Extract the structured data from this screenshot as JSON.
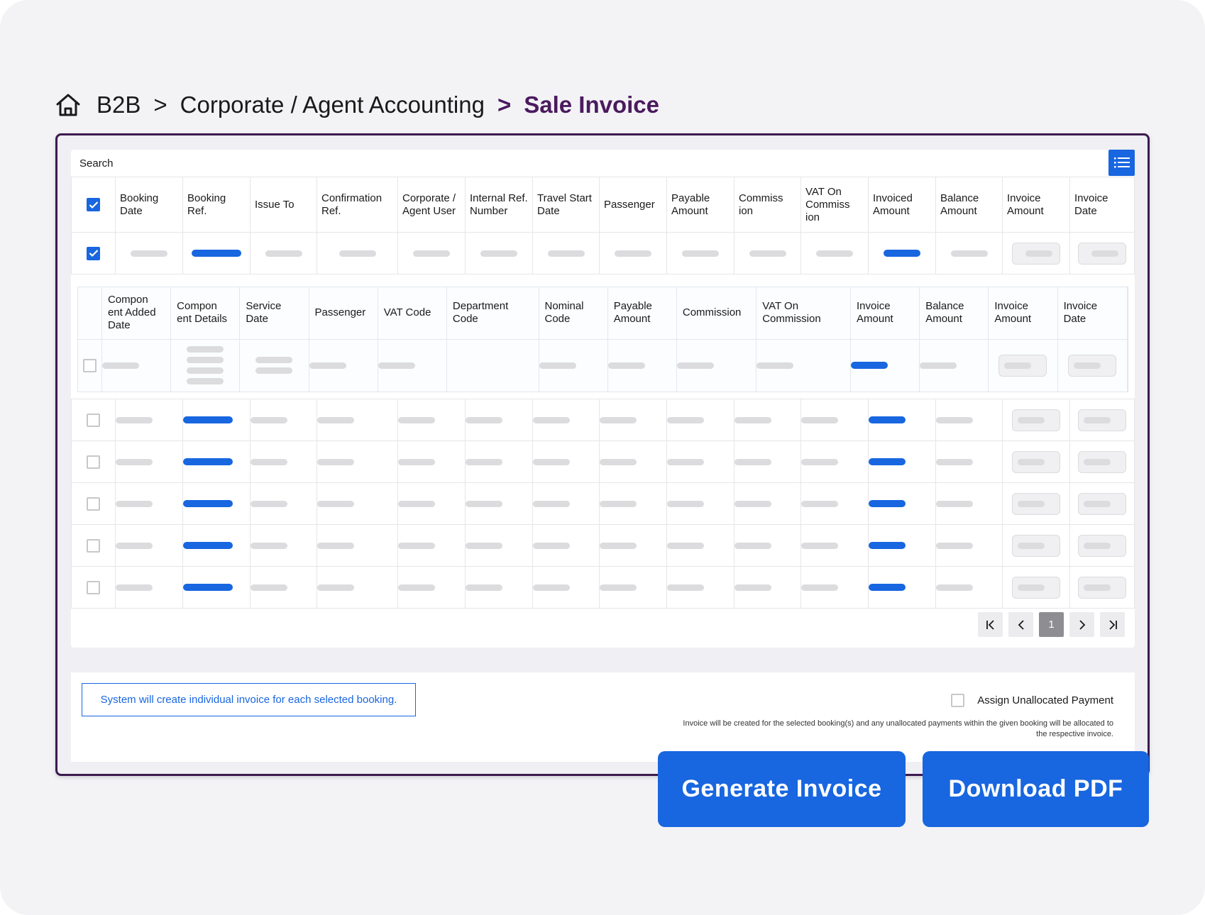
{
  "breadcrumb": {
    "home_icon": "home-icon",
    "level1": "B2B",
    "sep1": ">",
    "level2": "Corporate / Agent Accounting",
    "sep2": ">",
    "current": "Sale Invoice"
  },
  "search": {
    "label": "Search",
    "menu_icon": "list-icon"
  },
  "main_table": {
    "headers": [
      "Booking Date",
      "Booking Ref.",
      "Issue To",
      "Confirmation Ref.",
      "Corporate / Agent User",
      "Internal Ref. Number",
      "Travel Start Date",
      "Passenger",
      "Payable Amount",
      "Commiss ion",
      "VAT On Commiss ion",
      "Invoiced Amount",
      "Balance Amount",
      "Invoice Amount",
      "Invoice Date"
    ],
    "header_checked": true,
    "expanded_row_checked": true
  },
  "sub_table": {
    "headers": [
      "Compon ent Added Date",
      "Compon ent Details",
      "Service Date",
      "Passenger",
      "VAT Code",
      "Department Code",
      "Nominal Code",
      "Payable Amount",
      "Commission",
      "VAT On Commission",
      "Invoice Amount",
      "Balance Amount",
      "Invoice Amount",
      "Invoice Date"
    ],
    "row_checked": false
  },
  "rows": [
    {
      "checked": false
    },
    {
      "checked": false
    },
    {
      "checked": false
    },
    {
      "checked": false
    },
    {
      "checked": false
    }
  ],
  "pagination": {
    "first_icon": "first-page-icon",
    "prev_icon": "prev-page-icon",
    "current_page": "1",
    "next_icon": "next-page-icon",
    "last_icon": "last-page-icon"
  },
  "footer": {
    "note": "System will create individual invoice for each selected booking.",
    "assign_label": "Assign Unallocated Payment",
    "assign_checked": false,
    "assign_note": "Invoice will be created for the selected booking(s) and any unallocated payments within the given booking will be allocated to the respective invoice."
  },
  "actions": {
    "generate": "Generate Invoice",
    "download": "Download PDF"
  },
  "colors": {
    "accent": "#1866e0",
    "breadcrumb_current": "#4b1a5e",
    "frame_border": "#3d1a4f",
    "placeholder": "#dcdcdf"
  }
}
